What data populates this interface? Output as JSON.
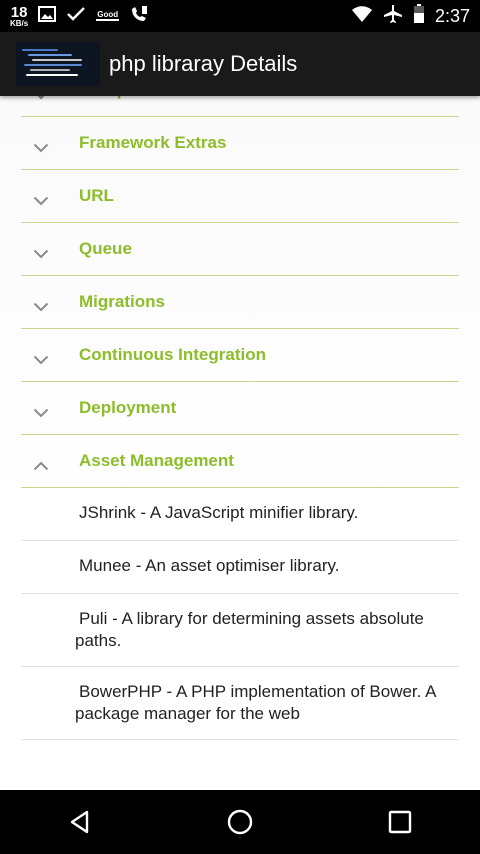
{
  "status_bar": {
    "speed_value": "18",
    "speed_unit": "KB/s",
    "good_label": "Good",
    "time": "2:37",
    "icons": [
      "image-icon",
      "check-icon",
      "good-signal-icon",
      "missed-call-icon",
      "wifi-icon",
      "airplane-icon",
      "battery-icon"
    ]
  },
  "app_bar": {
    "title": "php libraray Details",
    "logo_icon": "code-snippet-logo"
  },
  "groups": [
    {
      "label": "Components",
      "expanded": false
    },
    {
      "label": "Framework Extras",
      "expanded": false
    },
    {
      "label": "URL",
      "expanded": false
    },
    {
      "label": "Queue",
      "expanded": false
    },
    {
      "label": "Migrations",
      "expanded": false
    },
    {
      "label": "Continuous Integration",
      "expanded": false
    },
    {
      "label": "Deployment",
      "expanded": false
    },
    {
      "label": "Asset Management",
      "expanded": true
    }
  ],
  "children": [
    {
      "label": "JShrink - A JavaScript minifier library."
    },
    {
      "label": "Munee - An asset optimiser library."
    },
    {
      "label": "Puli - A library for determining assets absolute paths."
    },
    {
      "label": "BowerPHP - A PHP implementation of Bower. A package manager for the web"
    }
  ],
  "colors": {
    "accent": "#8cbd2a",
    "divider": "#c7d78f",
    "app_bar": "#1a1a1a"
  },
  "nav_bar": {
    "icons": [
      "back-icon",
      "home-icon",
      "recents-icon"
    ]
  }
}
